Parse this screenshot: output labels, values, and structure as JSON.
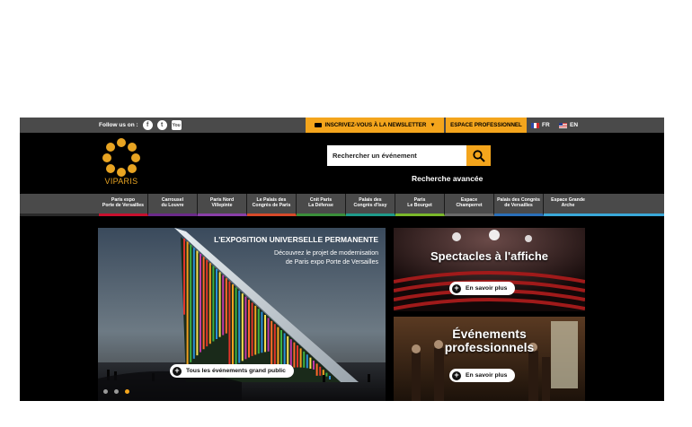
{
  "topbar": {
    "follow_label": "Follow us on :",
    "social": [
      {
        "icon": "facebook-icon",
        "glyph": "f"
      },
      {
        "icon": "twitter-icon",
        "glyph": "t"
      },
      {
        "icon": "youtube-icon",
        "glyph": "You"
      }
    ],
    "newsletter_label": "INSCRIVEZ-VOUS À LA NEWSLETTER",
    "pro_label": "ESPACE PROFESSIONNEL",
    "lang_fr": "FR",
    "lang_en": "EN"
  },
  "header": {
    "logo_text": "VIPARIS",
    "search_value": "Rechercher un événement",
    "advanced_search": "Recherche avancée"
  },
  "nav": {
    "items": [
      {
        "line1": "Paris expo",
        "line2": "Porte de Versailles",
        "accent": "#c8102e"
      },
      {
        "line1": "Carrousel",
        "line2": "du Louvre",
        "accent": "#6b2a8a"
      },
      {
        "line1": "Paris Nord",
        "line2": "Villepinte",
        "accent": "#8a3fa8"
      },
      {
        "line1": "Le Palais des",
        "line2": "Congrès de Paris",
        "accent": "#d64a2a"
      },
      {
        "line1": "Cnit Paris",
        "line2": "La Défense",
        "accent": "#3a8f3a"
      },
      {
        "line1": "Palais des",
        "line2": "Congrès d'Issy",
        "accent": "#1e9a8a"
      },
      {
        "line1": "Paris",
        "line2": "Le Bourget",
        "accent": "#7ab82a"
      },
      {
        "line1": "Espace",
        "line2": "Champerret",
        "accent": "#6a6a6a"
      },
      {
        "line1": "Palais des Congrès",
        "line2": "de Versailles",
        "accent": "#2a6fb8"
      },
      {
        "line1": "Espace Grande",
        "line2": "Arche",
        "accent": "#3aa8d8"
      }
    ]
  },
  "hero": {
    "title": "L'EXPOSITION UNIVERSELLE PERMANENTE",
    "subtitle_line1": "Découvrez le projet de modernisation",
    "subtitle_line2": "de Paris expo Porte de Versailles",
    "cta": "Tous les événements grand public",
    "slides_active": 3
  },
  "cards": [
    {
      "title": "Spectacles à l'affiche",
      "cta": "En savoir plus"
    },
    {
      "title_line1": "Événements",
      "title_line2": "professionnels",
      "cta": "En savoir plus"
    }
  ],
  "colors": {
    "accent": "#f4a51c",
    "topbar": "#4a4a4a",
    "background": "#000000"
  }
}
